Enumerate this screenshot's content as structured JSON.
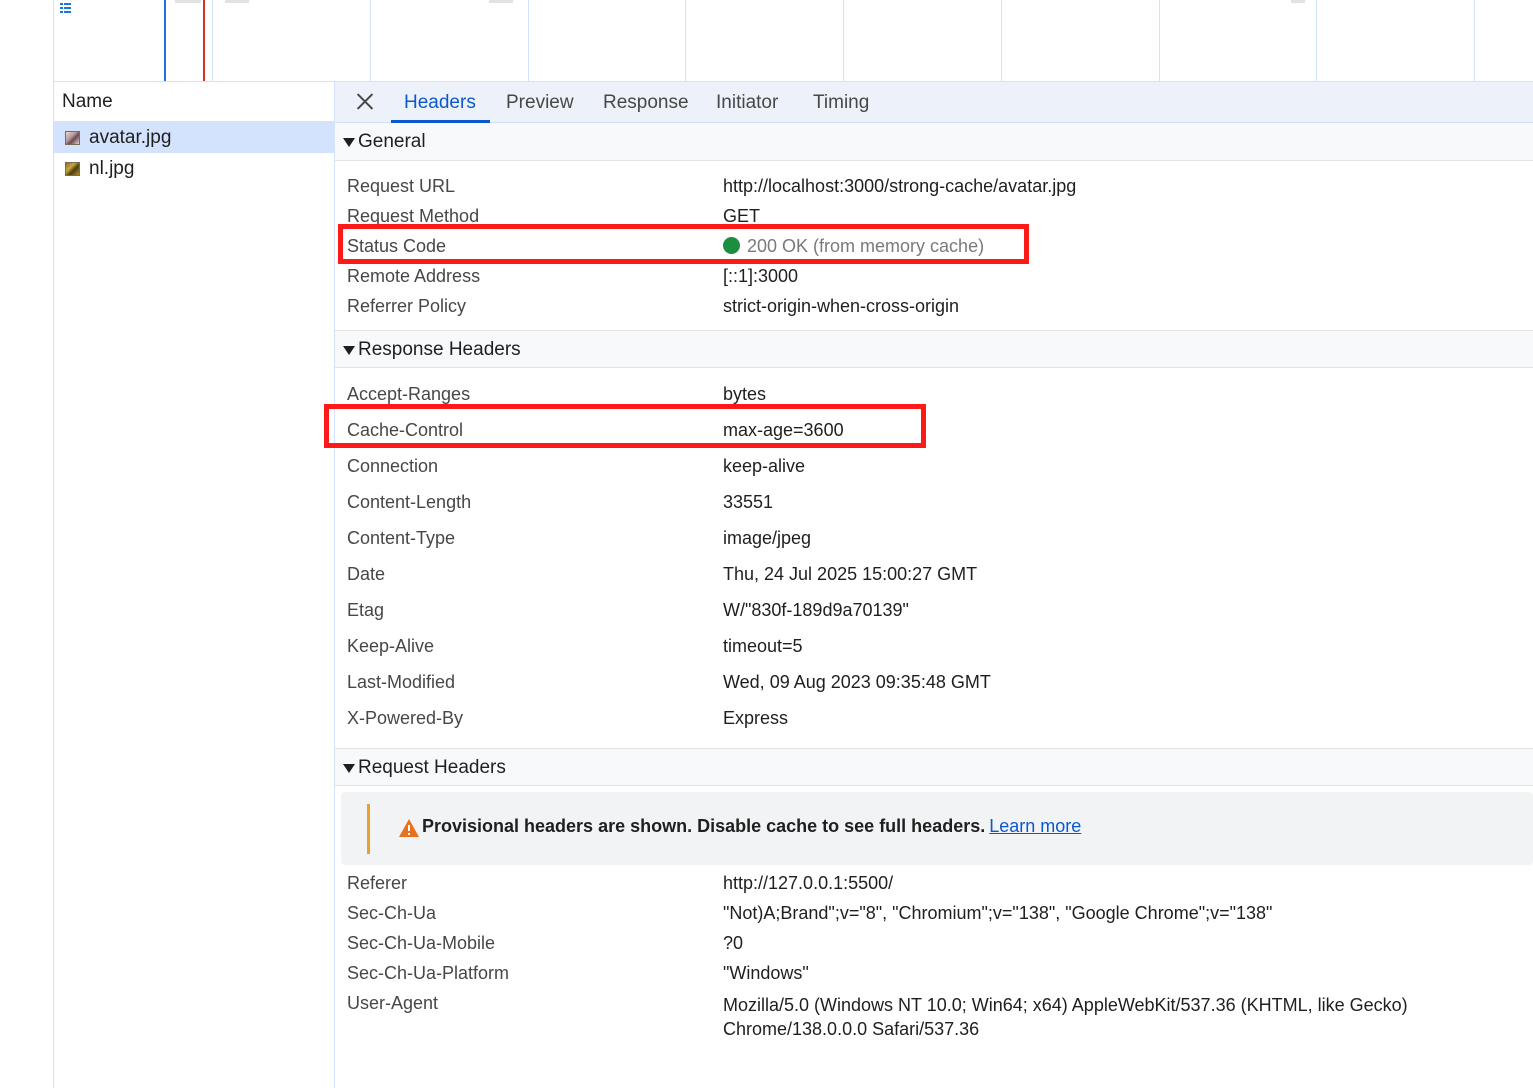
{
  "name_column": {
    "header": "Name",
    "files": [
      {
        "name": "avatar.jpg",
        "icon": "image-file-icon",
        "selected": true
      },
      {
        "name": "nl.jpg",
        "icon": "image-file-icon",
        "selected": false
      }
    ]
  },
  "tabs": [
    "Headers",
    "Preview",
    "Response",
    "Initiator",
    "Timing"
  ],
  "active_tab": "Headers",
  "general": {
    "title": "General",
    "rows": [
      {
        "key": "Request URL",
        "value": "http://localhost:3000/strong-cache/avatar.jpg"
      },
      {
        "key": "Request Method",
        "value": "GET"
      },
      {
        "key": "Status Code",
        "value": "200 OK (from memory cache)"
      },
      {
        "key": "Remote Address",
        "value": "[::1]:3000"
      },
      {
        "key": "Referrer Policy",
        "value": "strict-origin-when-cross-origin"
      }
    ]
  },
  "response_headers": {
    "title": "Response Headers",
    "rows": [
      {
        "key": "Accept-Ranges",
        "value": "bytes"
      },
      {
        "key": "Cache-Control",
        "value": "max-age=3600"
      },
      {
        "key": "Connection",
        "value": "keep-alive"
      },
      {
        "key": "Content-Length",
        "value": "33551"
      },
      {
        "key": "Content-Type",
        "value": "image/jpeg"
      },
      {
        "key": "Date",
        "value": "Thu, 24 Jul 2025 15:00:27 GMT"
      },
      {
        "key": "Etag",
        "value": "W/\"830f-189d9a70139\""
      },
      {
        "key": "Keep-Alive",
        "value": "timeout=5"
      },
      {
        "key": "Last-Modified",
        "value": "Wed, 09 Aug 2023 09:35:48 GMT"
      },
      {
        "key": "X-Powered-By",
        "value": "Express"
      }
    ]
  },
  "request_headers": {
    "title": "Request Headers",
    "warning": "Provisional headers are shown. Disable cache to see full headers.",
    "warning_link": "Learn more",
    "rows": [
      {
        "key": "Referer",
        "value": "http://127.0.0.1:5500/"
      },
      {
        "key": "Sec-Ch-Ua",
        "value": "\"Not)A;Brand\";v=\"8\", \"Chromium\";v=\"138\", \"Google Chrome\";v=\"138\""
      },
      {
        "key": "Sec-Ch-Ua-Mobile",
        "value": "?0"
      },
      {
        "key": "Sec-Ch-Ua-Platform",
        "value": "\"Windows\""
      },
      {
        "key": "User-Agent",
        "value": "Mozilla/5.0 (Windows NT 10.0; Win64; x64) AppleWebKit/537.36 (KHTML, like Gecko) Chrome/138.0.0.0 Safari/537.36"
      }
    ]
  },
  "colors": {
    "accent": "#0b57d0",
    "status_ok": "#1e8e3e",
    "highlight": "#ff1a1a",
    "warning": "#e8a12c"
  }
}
